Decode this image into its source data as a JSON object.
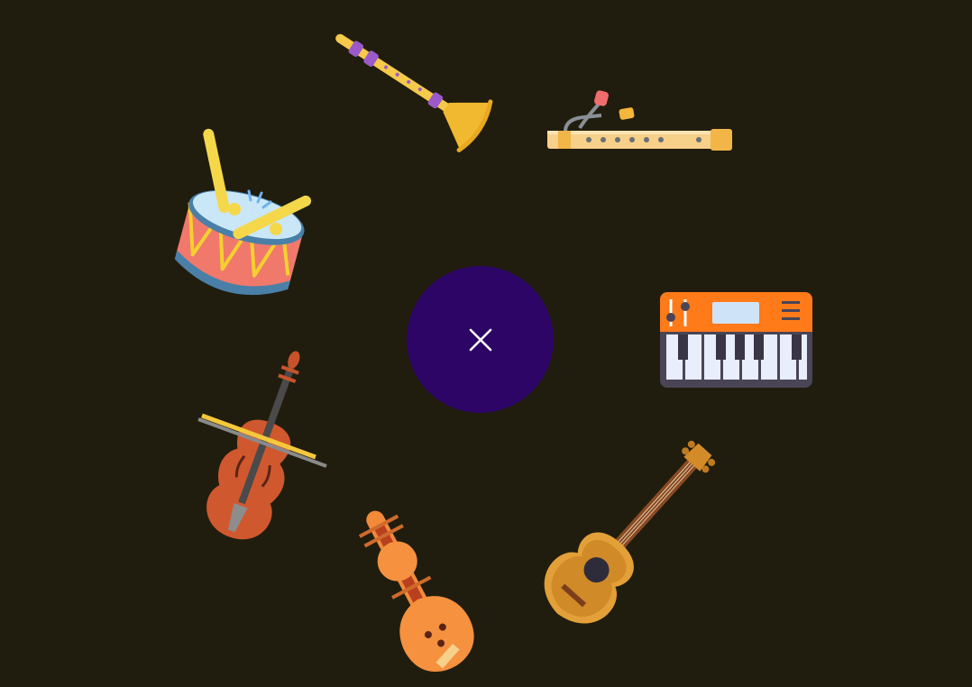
{
  "menu": {
    "close_icon": "close-icon",
    "center_color": "#2c0566",
    "background_color": "#201d0e",
    "instruments": [
      {
        "id": "trumpet",
        "icon": "trumpet-icon"
      },
      {
        "id": "flute",
        "icon": "flute-icon"
      },
      {
        "id": "drum",
        "icon": "drum-icon"
      },
      {
        "id": "keyboard",
        "icon": "keyboard-icon"
      },
      {
        "id": "violin",
        "icon": "violin-icon"
      },
      {
        "id": "sitar",
        "icon": "sitar-icon"
      },
      {
        "id": "guitar",
        "icon": "guitar-icon"
      }
    ]
  }
}
